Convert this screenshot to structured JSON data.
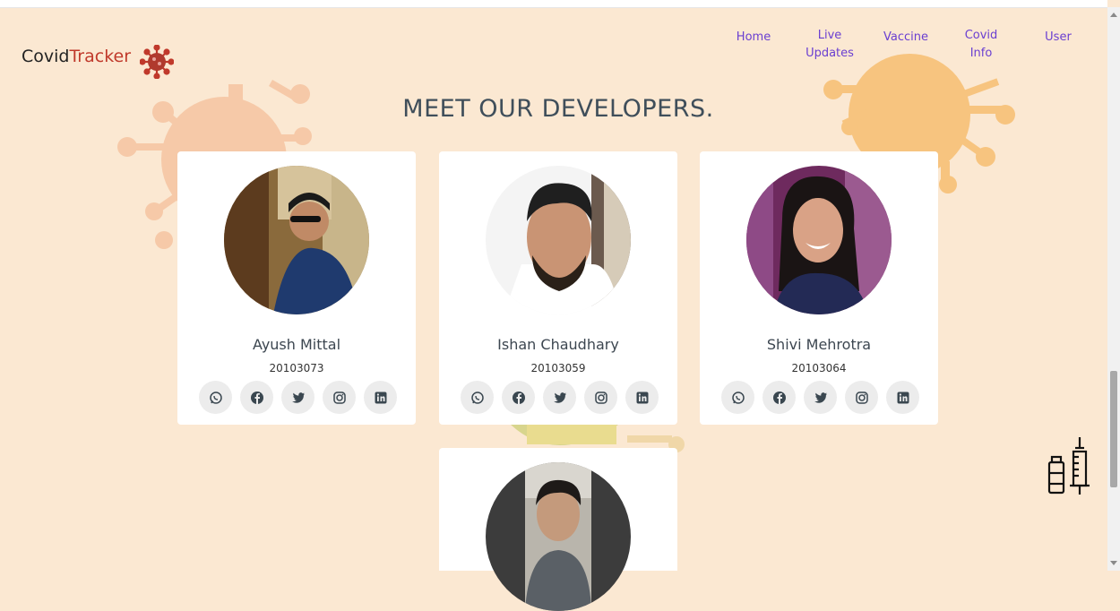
{
  "brand": {
    "part1": "Covid",
    "part2": "Tracker",
    "logo_icon": "virus-icon"
  },
  "nav": [
    {
      "line1": "Home",
      "line2": ""
    },
    {
      "line1": "Live",
      "line2": "Updates"
    },
    {
      "line1": "Vaccine",
      "line2": ""
    },
    {
      "line1": "Covid",
      "line2": "Info"
    },
    {
      "line1": "User",
      "line2": ""
    }
  ],
  "section_title": "MEET OUR DEVELOPERS.",
  "developers": [
    {
      "name": "Ayush Mittal",
      "roll": "20103073"
    },
    {
      "name": "Ishan Chaudhary",
      "roll": "20103059"
    },
    {
      "name": "Shivi Mehrotra",
      "roll": "20103064"
    }
  ],
  "social_icons": [
    "whatsapp-icon",
    "facebook-icon",
    "twitter-icon",
    "instagram-icon",
    "linkedin-icon"
  ],
  "colors": {
    "background": "#fbe8d2",
    "nav_link": "#6a3fd1",
    "brand_accent": "#c0392b",
    "title": "#3f4e5a"
  }
}
